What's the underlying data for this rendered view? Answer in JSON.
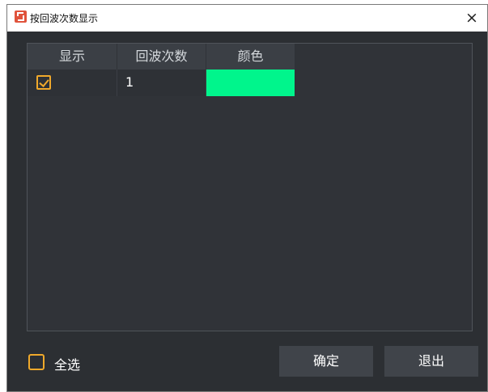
{
  "window": {
    "title": "按回波次数显示",
    "close_glyph": "×"
  },
  "table": {
    "columns": [
      "显示",
      "回波次数",
      "颜色"
    ],
    "rows": [
      {
        "checked": true,
        "echo_count": "1",
        "color": "#00f58c"
      }
    ]
  },
  "footer": {
    "select_all_label": "全选",
    "select_all_checked": false,
    "ok_label": "确定",
    "exit_label": "退出"
  },
  "colors": {
    "accent": "#f0a92b",
    "background": "#2c2f33",
    "header_bg": "#3b3f45",
    "button_bg": "#40444a"
  }
}
